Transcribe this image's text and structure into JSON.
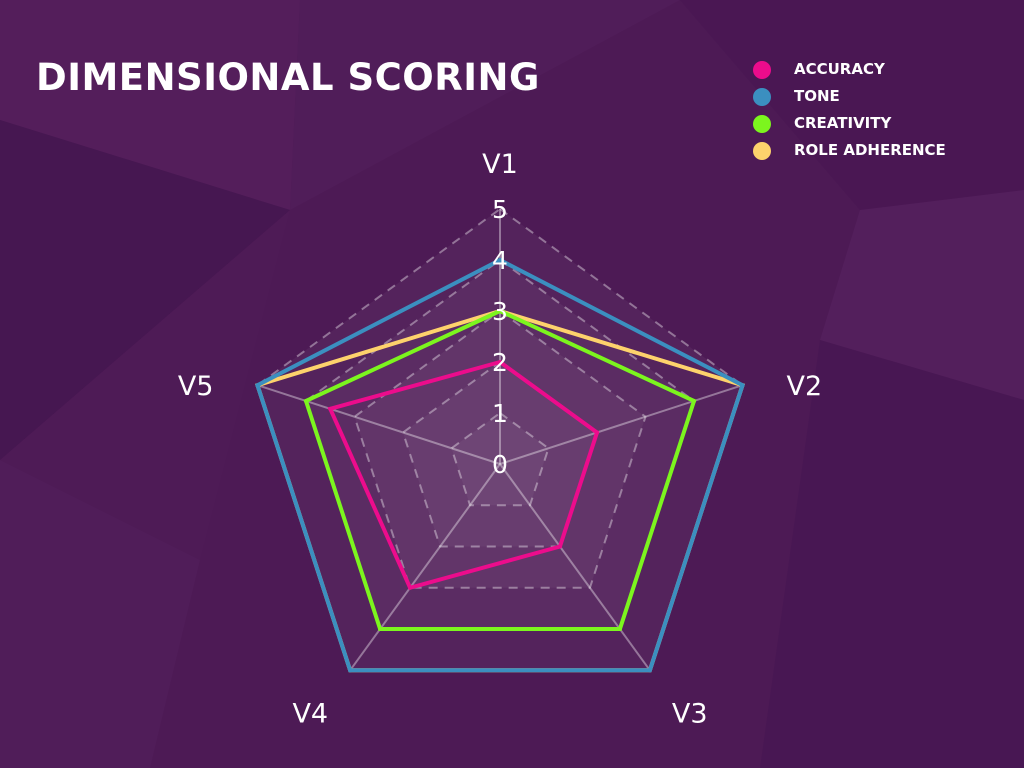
{
  "colors": {
    "background": "#4d1a55",
    "accuracy": "#ec0c8c",
    "tone": "#3b8fc0",
    "creativity": "#7cf51e",
    "role_adherence": "#fdd26c"
  },
  "chart_data": {
    "type": "radar",
    "title": "DIMENSIONAL SCORING",
    "axes": [
      "V1",
      "V2",
      "V3",
      "V4",
      "V5"
    ],
    "rlim": [
      0,
      5
    ],
    "ticks": [
      "0",
      "1",
      "2",
      "3",
      "4",
      "5"
    ],
    "grid": "dashed",
    "legend_position": "top-right",
    "series": [
      {
        "name": "ACCURACY",
        "values": [
          2,
          2,
          2,
          3,
          3.5
        ],
        "color": "#ec0c8c"
      },
      {
        "name": "TONE",
        "values": [
          4,
          5,
          5,
          5,
          5
        ],
        "color": "#3b8fc0"
      },
      {
        "name": "CREATIVITY",
        "values": [
          3,
          4,
          4,
          4,
          4
        ],
        "color": "#7cf51e"
      },
      {
        "name": "ROLE ADHERENCE",
        "values": [
          3,
          5,
          5,
          5,
          5
        ],
        "color": "#fdd26c"
      }
    ]
  }
}
